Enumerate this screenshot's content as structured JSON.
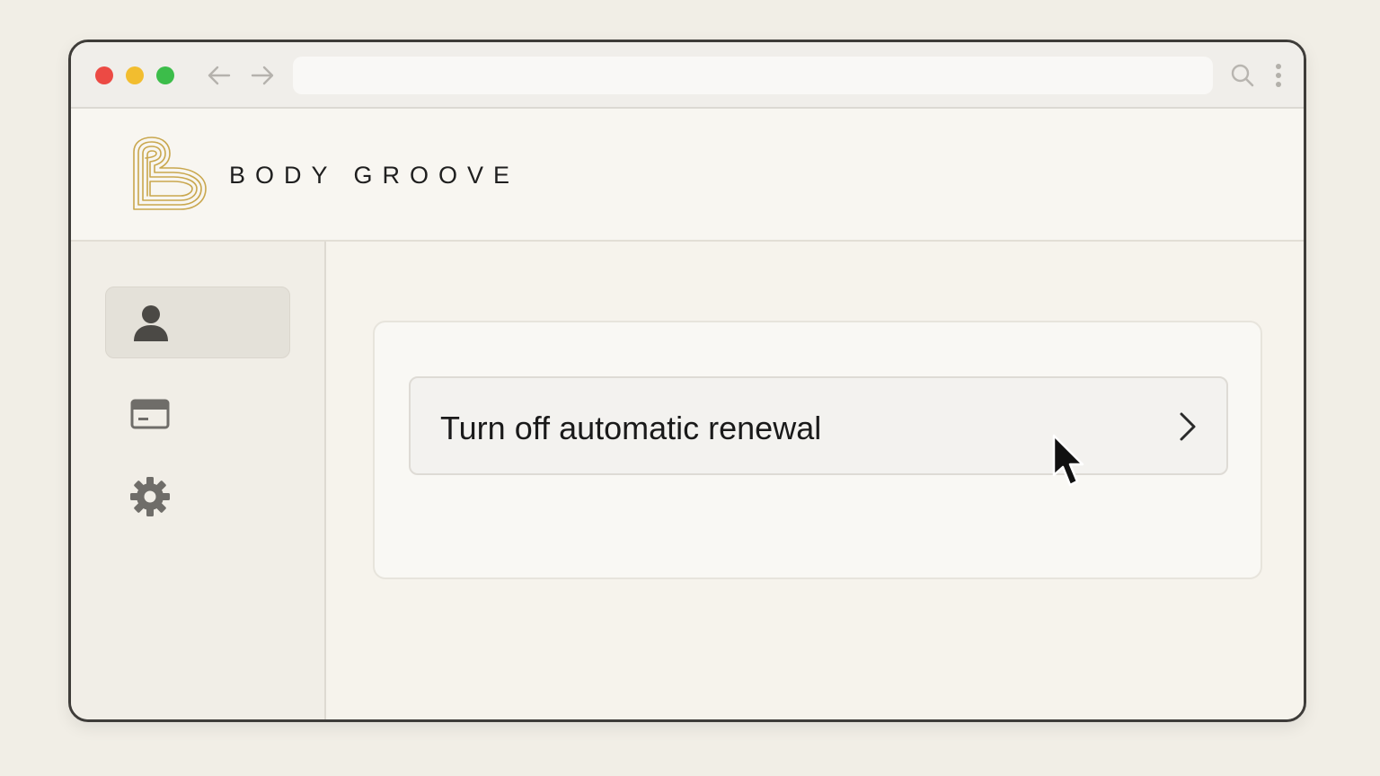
{
  "browser": {
    "address_value": "",
    "icons": [
      "back-arrow-icon",
      "forward-arrow-icon",
      "search-icon",
      "more-vertical-icon"
    ]
  },
  "header": {
    "brand": "BODY GROOVE",
    "logo_color": "#c9a74e"
  },
  "sidebar": {
    "items": [
      {
        "icon": "user-icon",
        "active": true
      },
      {
        "icon": "credit-card-icon",
        "active": false
      },
      {
        "icon": "gear-icon",
        "active": false
      }
    ]
  },
  "main": {
    "action_label": "Turn off automatic renewal"
  },
  "colors": {
    "close": "#ec4a44",
    "minimize": "#f2bd2f",
    "zoom": "#3cbd4a",
    "accent_gold": "#c9a74e"
  }
}
